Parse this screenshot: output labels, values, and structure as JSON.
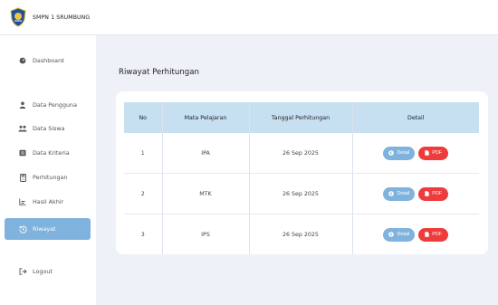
{
  "app": {
    "brand": "SMPN 1 SRUMBUNG"
  },
  "sidebar": {
    "items": [
      {
        "label": "Dashboard",
        "icon": "dashboard-icon",
        "active": false
      },
      {
        "label": "Data Pengguna",
        "icon": "user-icon",
        "active": false
      },
      {
        "label": "Data Siswa",
        "icon": "users-icon",
        "active": false
      },
      {
        "label": "Data Kriteria",
        "icon": "criteria-icon",
        "active": false
      },
      {
        "label": "Perhitungan",
        "icon": "calculator-icon",
        "active": false
      },
      {
        "label": "Hasil Akhir",
        "icon": "chart-icon",
        "active": false
      },
      {
        "label": "Riwayat",
        "icon": "history-icon",
        "active": true
      },
      {
        "label": "Logout",
        "icon": "logout-icon",
        "active": false
      }
    ]
  },
  "main": {
    "title": "Riwayat Perhitungan",
    "table": {
      "headers": [
        "No",
        "Mata Pelajaran",
        "Tanggal Perhitungan",
        "Detail"
      ],
      "rows": [
        {
          "no": "1",
          "subject": "IPA",
          "date": "26 Sep 2025"
        },
        {
          "no": "2",
          "subject": "MTK",
          "date": "26 Sep 2025"
        },
        {
          "no": "3",
          "subject": "IPS",
          "date": "26 Sep 2025"
        }
      ],
      "detail_label": "Detail",
      "pdf_label": "PDF"
    }
  },
  "colors": {
    "accent": "#7fb2dc",
    "header_bg": "#c6dff1",
    "pdf": "#ee3b3b",
    "page_bg": "#eef1f8"
  }
}
